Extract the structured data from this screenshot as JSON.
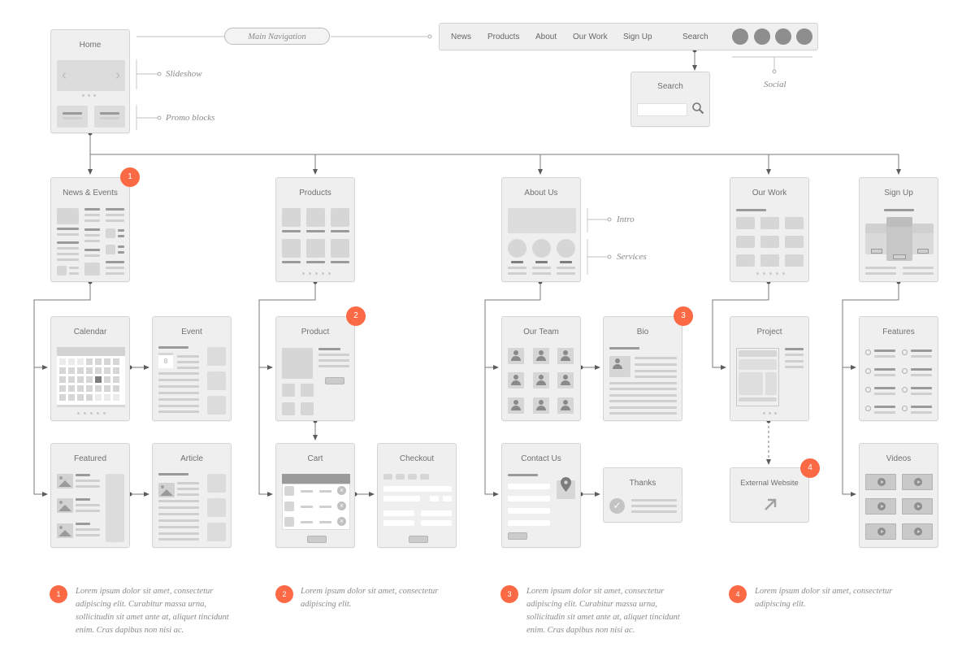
{
  "header": {
    "home_card": "Home",
    "main_navigation_label": "Main Navigation",
    "slideshow_label": "Slideshow",
    "promo_label": "Promo blocks",
    "social_label": "Social",
    "nav_items": [
      "News",
      "Products",
      "About",
      "Our Work",
      "Sign Up",
      "Search"
    ],
    "search_card": "Search",
    "search_icon": "search-icon"
  },
  "sections": {
    "news": {
      "title": "News & Events",
      "badge": "1"
    },
    "products": {
      "title": "Products"
    },
    "about": {
      "title": "About Us",
      "intro_label": "Intro",
      "services_label": "Services"
    },
    "work": {
      "title": "Our Work"
    },
    "signup": {
      "title": "Sign Up"
    }
  },
  "subpages": {
    "calendar": {
      "title": "Calendar"
    },
    "event": {
      "title": "Event",
      "date": "8"
    },
    "featured": {
      "title": "Featured"
    },
    "article": {
      "title": "Article"
    },
    "product": {
      "title": "Product",
      "badge": "2"
    },
    "cart": {
      "title": "Cart"
    },
    "checkout": {
      "title": "Checkout"
    },
    "team": {
      "title": "Our Team"
    },
    "bio": {
      "title": "Bio",
      "badge": "3"
    },
    "contact": {
      "title": "Contact Us"
    },
    "thanks": {
      "title": "Thanks"
    },
    "project": {
      "title": "Project"
    },
    "external": {
      "title": "External Website",
      "badge": "4"
    },
    "features": {
      "title": "Features"
    },
    "videos": {
      "title": "Videos"
    }
  },
  "footnotes": [
    {
      "num": "1",
      "text": "Lorem ipsum dolor sit amet, consectetur adipiscing elit. Curabitur massa urna, sollicitudin sit amet ante at, aliquet tincidunt enim. Cras dapibus non nisi ac."
    },
    {
      "num": "2",
      "text": "Lorem ipsum dolor sit amet, consectetur adipiscing elit."
    },
    {
      "num": "3",
      "text": "Lorem ipsum dolor sit amet, consectetur adipiscing elit. Curabitur massa urna, sollicitudin sit amet ante at, aliquet tincidunt enim. Cras dapibus non nisi ac."
    },
    {
      "num": "4",
      "text": "Lorem ipsum dolor sit amet, consectetur adipiscing elit."
    }
  ],
  "colors": {
    "accent": "#fb6a45",
    "card_bg": "#efefef",
    "connector": "#6b6b6b"
  }
}
